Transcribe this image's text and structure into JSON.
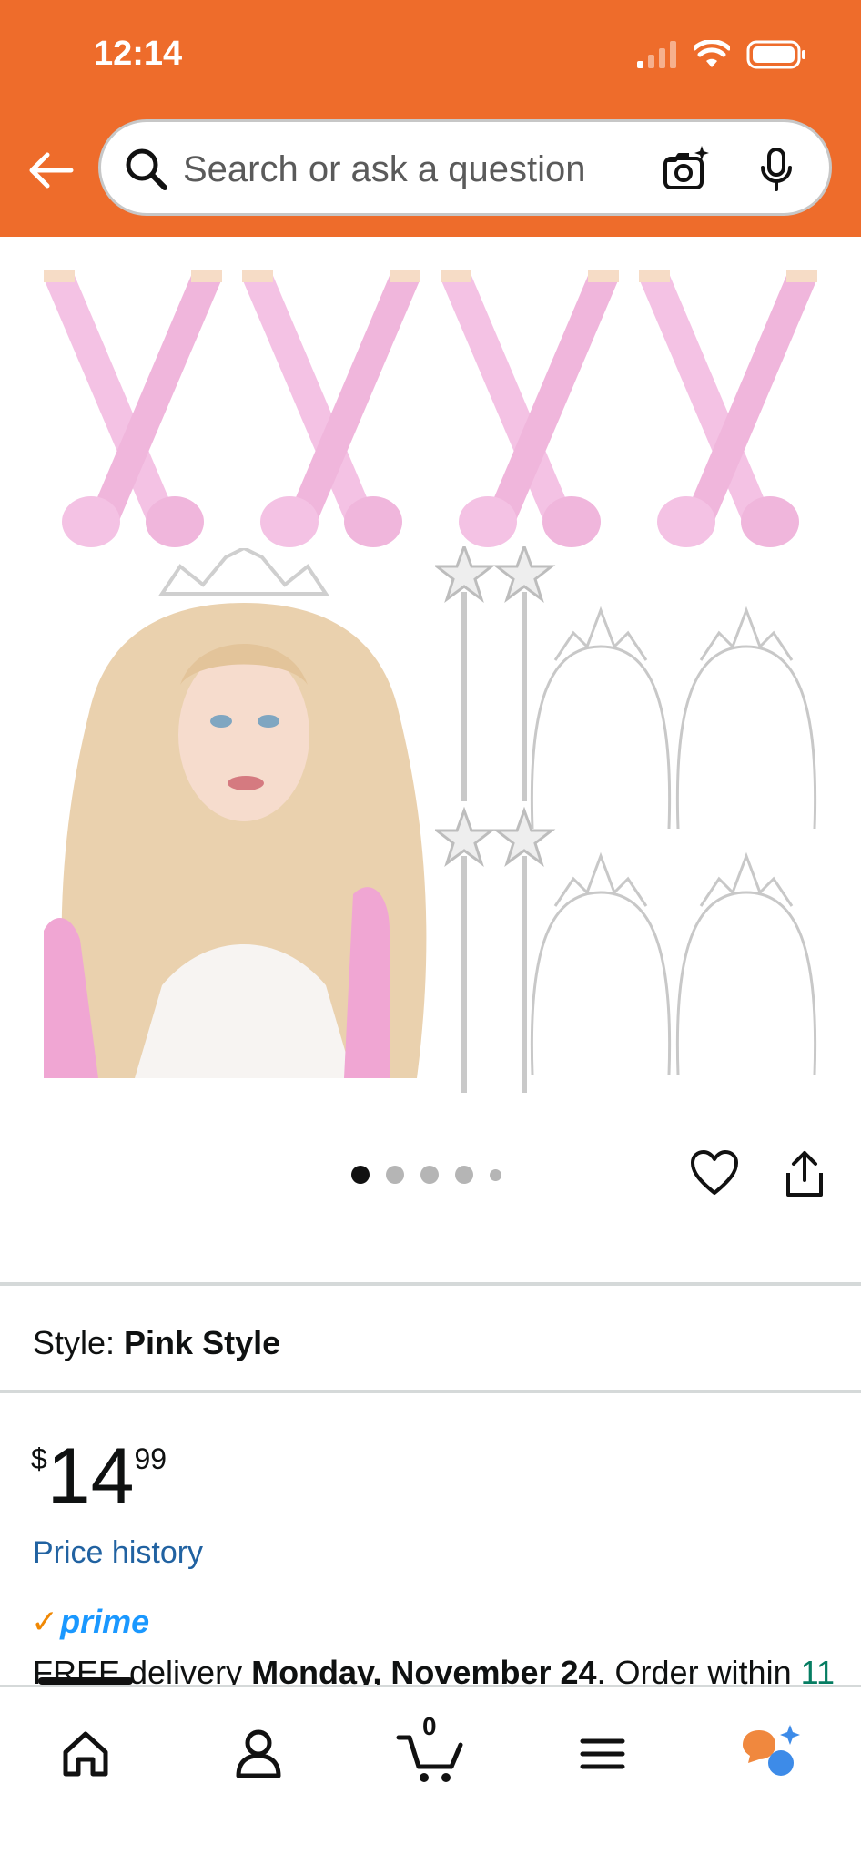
{
  "status_bar": {
    "time": "12:14"
  },
  "search": {
    "placeholder": "Search or ask a question"
  },
  "icons": {
    "back": "back-arrow-icon",
    "search": "search-icon",
    "camera": "camera-icon",
    "mic": "microphone-icon",
    "heart": "heart-icon",
    "share": "share-icon",
    "home": "home-icon",
    "account": "account-icon",
    "cart": "cart-icon",
    "menu": "menu-icon",
    "assistant": "assistant-icon"
  },
  "carousel": {
    "total_dots": 5,
    "active_index": 0
  },
  "style": {
    "label": "Style:",
    "value": "Pink Style"
  },
  "price": {
    "symbol": "$",
    "whole": "14",
    "fraction": "99"
  },
  "price_history": "Price history",
  "prime": {
    "check": "✓",
    "label": "prime"
  },
  "delivery": {
    "prefix": "FREE delivery ",
    "date": "Monday, November 24",
    "middle": ". Order within ",
    "countdown": "11"
  },
  "cart": {
    "count": "0"
  },
  "colors": {
    "header": "#ee6c2b",
    "link": "#2162a1",
    "prime_blue": "#1a98ff",
    "prime_check": "#f08804",
    "glove_pink": "#f4c2e4"
  }
}
